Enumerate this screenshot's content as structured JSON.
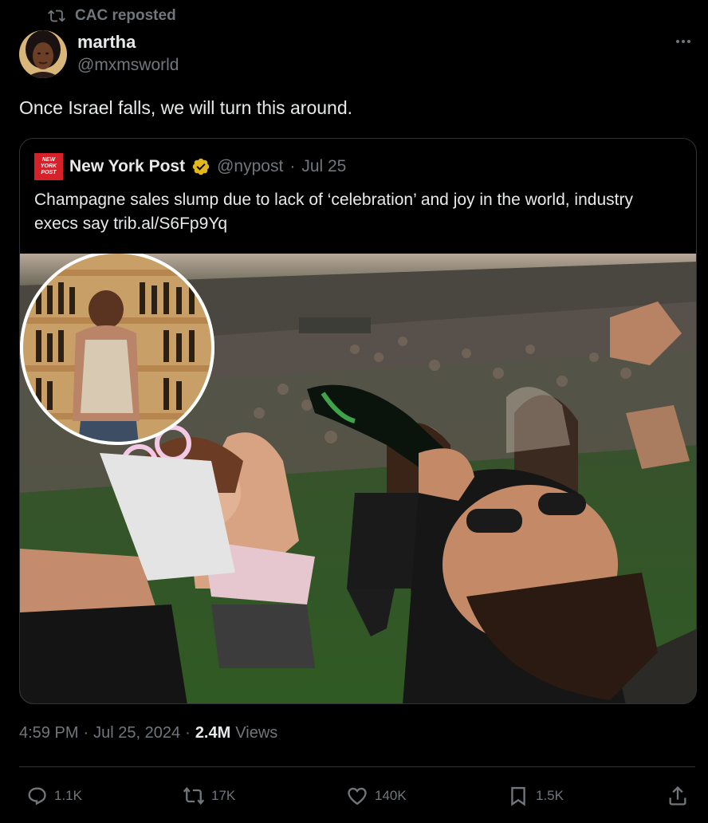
{
  "repost": {
    "label": "CAC reposted",
    "icon": "repost-icon"
  },
  "author": {
    "name": "martha",
    "handle": "@mxmsworld",
    "avatar": "avatar"
  },
  "tweet": {
    "text": "Once Israel falls, we will turn this around."
  },
  "quote": {
    "name": "New York Post",
    "logo_text": [
      "NEW",
      "YORK",
      "POST"
    ],
    "handle": "@nypost",
    "separator": "·",
    "date": "Jul 25",
    "text": "Champagne sales slump due to lack of ‘celebration’ and joy in the world, industry execs say trib.al/S6Fp9Yq",
    "verified_color": "#e2b719",
    "logo_color": "#d4212a"
  },
  "meta": {
    "time": "4:59 PM",
    "sep1": "·",
    "date": "Jul 25, 2024",
    "sep2": "·",
    "views_count": "2.4M",
    "views_label": "Views"
  },
  "actions": {
    "replies": "1.1K",
    "reposts": "17K",
    "likes": "140K",
    "bookmarks": "1.5K"
  },
  "colors": {
    "background": "#000000",
    "text": "#e7e9ea",
    "muted": "#71767b",
    "border": "#2f3336"
  }
}
